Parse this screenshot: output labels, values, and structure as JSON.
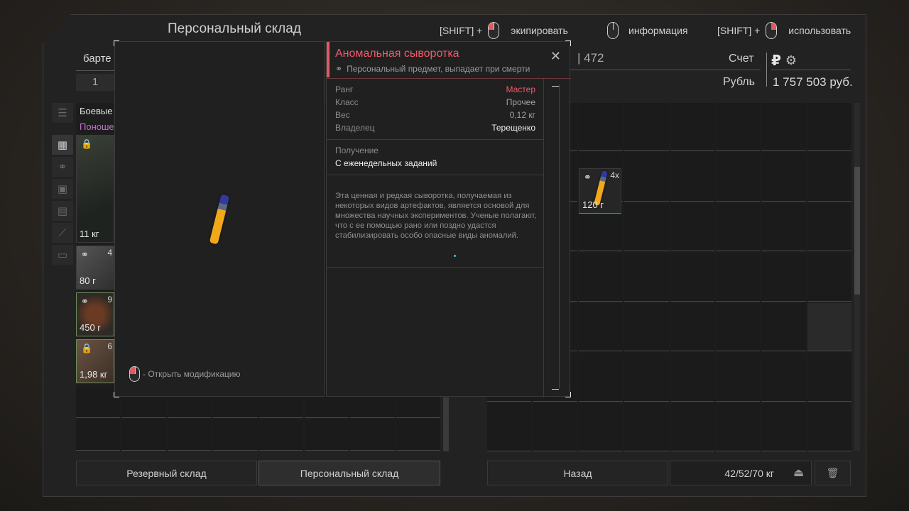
{
  "header": {
    "title": "Персональный склад",
    "hint_equip": {
      "prefix": "[SHIFT] +",
      "label": "экипировать"
    },
    "hint_info": {
      "label": "информация"
    },
    "hint_use": {
      "prefix": "[SHIFT] +",
      "label": "использовать"
    }
  },
  "left_panel": {
    "partial_tab": "барте",
    "page_number": "1",
    "category_title": "Боевые",
    "category_sub": "Поноше",
    "items": [
      {
        "weight": "11 кг",
        "count": ""
      },
      {
        "weight": "80 г",
        "count": "4"
      },
      {
        "weight": "450 г",
        "count": "9"
      },
      {
        "weight": "1,98 кг",
        "count": "6"
      }
    ]
  },
  "right_panel": {
    "partial_number": "| 472",
    "account_label": "Счет",
    "currency_label": "Рубль",
    "balance": "1 757 503 руб.",
    "currency_symbol": "₽",
    "item": {
      "count": "4x",
      "weight": "120 г"
    }
  },
  "popup": {
    "open_mod_hint": "- Открыть модификацию",
    "name": "Аномальная сыворотка",
    "subtitle": "Персональный предмет, выпадает при смерти",
    "stats": [
      {
        "key": "Ранг",
        "value": "Мастер",
        "color": "#f05a68"
      },
      {
        "key": "Класс",
        "value": "Прочее",
        "color": "#a0a0a0"
      },
      {
        "key": "Вес",
        "value": "0,12 кг",
        "color": "#a0a0a0"
      },
      {
        "key": "Владелец",
        "value": "Терещенко",
        "color": "#f0f0f0"
      }
    ],
    "obtain_label": "Получение",
    "obtain_value": "С еженедельных заданий",
    "description": "Эта ценная и редкая сыворотка, получаемая из некоторых видов артефактов, является основой для множества научных экспериментов. Ученые полагают, что с ее помощью рано или поздно удастся стабилизировать особо опасные виды аномалий."
  },
  "footer": {
    "reserve_storage": "Резервный склад",
    "personal_storage": "Персональный склад",
    "back": "Назад",
    "weight": "42/52/70 кг"
  },
  "colors": {
    "accent_red": "#e05a64",
    "purple": "#c36fd0",
    "green_border": "#6a8f5a"
  }
}
